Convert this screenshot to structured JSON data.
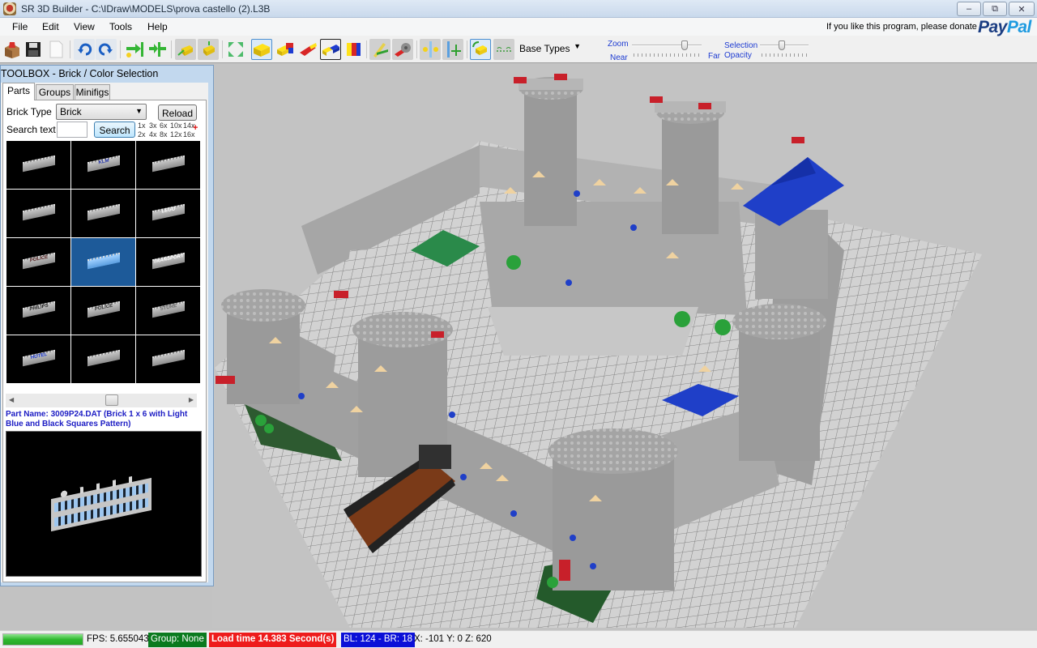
{
  "window": {
    "title": "SR 3D Builder - C:\\IDraw\\MODELS\\prova castello (2).L3B",
    "controls": {
      "minimize": "–",
      "restore": "⧉",
      "close": "✕"
    }
  },
  "menu": [
    "File",
    "Edit",
    "View",
    "Tools",
    "Help"
  ],
  "toolbar": {
    "buttons": [
      {
        "name": "open",
        "icon": "open-box-icon"
      },
      {
        "name": "save",
        "icon": "floppy-save-icon"
      },
      {
        "name": "new",
        "icon": "new-document-icon"
      },
      {
        "name": "undo",
        "icon": "undo-icon"
      },
      {
        "name": "redo",
        "icon": "redo-icon"
      },
      {
        "name": "add-brick",
        "icon": "insert-brick-icon"
      },
      {
        "name": "align",
        "icon": "align-icon"
      },
      {
        "name": "move-brick",
        "icon": "move-brick-icon"
      },
      {
        "name": "place-brick",
        "icon": "place-brick-icon"
      },
      {
        "name": "expand",
        "icon": "expand-arrows-icon"
      },
      {
        "name": "brick-mode",
        "icon": "yellow-brick-icon",
        "selected": true
      },
      {
        "name": "color-brick",
        "icon": "multicolor-brick-icon"
      },
      {
        "name": "slope",
        "icon": "red-slope-icon"
      },
      {
        "name": "connect",
        "icon": "connect-bricks-icon",
        "selected": true
      },
      {
        "name": "paint",
        "icon": "paint-colors-icon"
      },
      {
        "name": "hinge",
        "icon": "hinge-icon"
      },
      {
        "name": "gear",
        "icon": "gear-technic-icon"
      },
      {
        "name": "mirror",
        "icon": "mirror-icon"
      },
      {
        "name": "vertical-move",
        "icon": "vertical-move-icon"
      },
      {
        "name": "rotate-select",
        "icon": "rotate-select-icon",
        "selected": true
      },
      {
        "name": "base-plate",
        "icon": "baseplate-icon"
      }
    ],
    "base_types": "Base Types",
    "zoom_label": "Zoom",
    "zoom_near": "Near",
    "zoom_far": "Far",
    "zoom_value": 0.75,
    "selection_label": "Selection",
    "opacity_label": "Opacity",
    "opacity_value": 0.45,
    "donate_text": "If you like this program, please donate",
    "paypal_a": "Pay",
    "paypal_b": "Pal"
  },
  "toolbox": {
    "title": "TOOLBOX - Brick / Color Selection",
    "tabs": [
      "Parts",
      "Groups",
      "Minifigs"
    ],
    "active_tab": "Parts",
    "brick_type_label": "Brick Type",
    "brick_type_value": "Brick",
    "reload": "Reload",
    "search_label": "Search text",
    "search_value": "",
    "search_button": "Search",
    "multipliers_top": [
      "1x",
      "3x",
      "6x",
      "10x",
      "14x"
    ],
    "multipliers_bottom": [
      "2x",
      "4x",
      "8x",
      "12x",
      "16x"
    ],
    "parts": [
      {
        "label": "",
        "color": "#555555"
      },
      {
        "label": "KLM",
        "color": "#2233aa"
      },
      {
        "label": "",
        "color": "#9fb8d0"
      },
      {
        "label": "",
        "color": "#9fb8d0"
      },
      {
        "label": "",
        "color": "#bbbbbb"
      },
      {
        "label": "LEGO",
        "color": "#ffffff"
      },
      {
        "label": "POLICE",
        "color": "#552222"
      },
      {
        "label": "",
        "color": "#7ab6f0",
        "selected": true
      },
      {
        "label": "TRANSPORT",
        "color": "#ffffff"
      },
      {
        "label": "PHILIPS",
        "color": "#222222"
      },
      {
        "label": "POLICE",
        "color": "#333333"
      },
      {
        "label": "STORE",
        "color": "#666666"
      },
      {
        "label": "HOTEL",
        "color": "#1d3bd1"
      },
      {
        "label": "",
        "color": "#333333"
      },
      {
        "label": "",
        "color": "#bbbbbb"
      }
    ],
    "part_name": "Part Name: 3009P24.DAT (Brick  1 x  6 with Light Blue and Black Squares Pattern)"
  },
  "status": {
    "progress": 1.0,
    "fps": "FPS:  5.655043",
    "group": "Group: None",
    "load_time": "Load time 14.383 Second(s)",
    "bricks": "BL: 124 - BR: 18",
    "coords": "X: -101 Y: 0 Z: 620",
    "colors": {
      "group": "#0a7a1e",
      "load": "#ee1c1c",
      "bricks": "#0b10d8"
    }
  }
}
